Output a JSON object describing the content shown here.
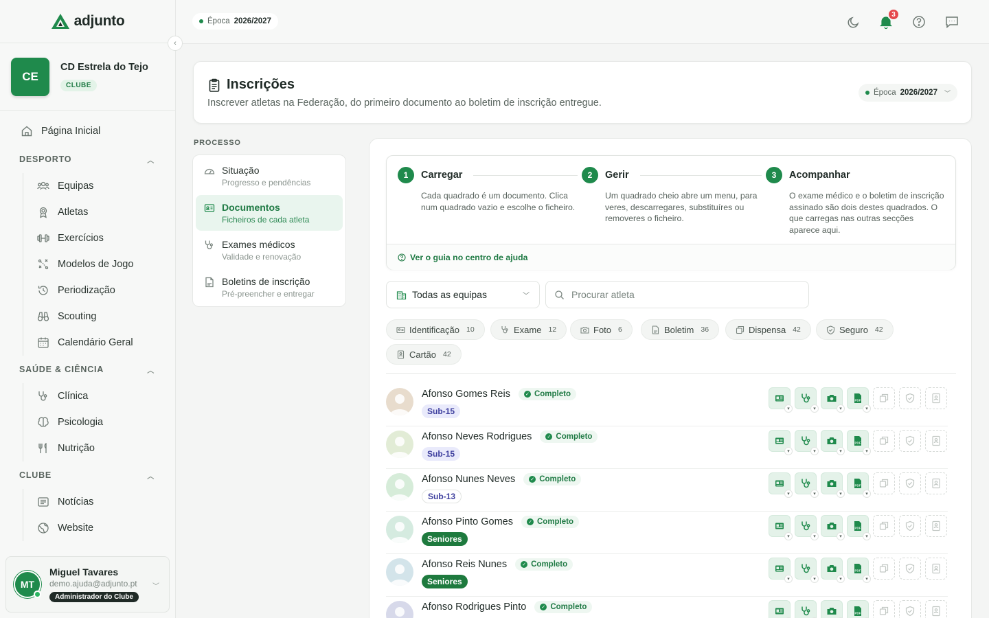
{
  "brand": {
    "name": "adjunto"
  },
  "club": {
    "initials": "CE",
    "name": "CD Estrela do Tejo",
    "badge": "CLUBE"
  },
  "nav": {
    "home": "Página Inicial",
    "sections": [
      {
        "label": "DESPORTO",
        "items": [
          "Equipas",
          "Atletas",
          "Exercícios",
          "Modelos de Jogo",
          "Periodização",
          "Scouting",
          "Calendário Geral"
        ]
      },
      {
        "label": "SAÚDE & CIÊNCIA",
        "items": [
          "Clínica",
          "Psicologia",
          "Nutrição"
        ]
      },
      {
        "label": "CLUBE",
        "items": [
          "Notícias",
          "Website"
        ]
      }
    ]
  },
  "user": {
    "initials": "MT",
    "name": "Miguel Tavares",
    "email": "demo.ajuda@adjunto.pt",
    "role": "Administrador do Clube"
  },
  "topbar": {
    "season_label": "Época",
    "season_value": "2026/2027",
    "notifications": "3"
  },
  "header": {
    "title": "Inscrições",
    "subtitle": "Inscrever atletas na Federação, do primeiro documento ao boletim de inscrição entregue.",
    "season_label": "Época",
    "season_value": "2026/2027"
  },
  "process": {
    "label": "PROCESSO",
    "items": [
      {
        "title": "Situação",
        "sub": "Progresso e pendências"
      },
      {
        "title": "Documentos",
        "sub": "Ficheiros de cada atleta"
      },
      {
        "title": "Exames médicos",
        "sub": "Validade e renovação"
      },
      {
        "title": "Boletins de inscrição",
        "sub": "Pré-preencher e entregar"
      }
    ]
  },
  "steps": [
    {
      "num": "1",
      "title": "Carregar",
      "text": "Cada quadrado é um documento. Clica num quadrado vazio e escolhe o ficheiro."
    },
    {
      "num": "2",
      "title": "Gerir",
      "text": "Um quadrado cheio abre um menu, para veres, descarregares, substituíres ou removeres o ficheiro."
    },
    {
      "num": "3",
      "title": "Acompanhar",
      "text": "O exame médico e o boletim de inscrição assinado são dois destes quadrados. O que carregas nas outras secções aparece aqui."
    }
  ],
  "guide_link": "Ver o guia no centro de ajuda",
  "team_select": "Todas as equipas",
  "search": {
    "placeholder": "Procurar atleta"
  },
  "filters": [
    {
      "label": "Identificação",
      "count": "10"
    },
    {
      "label": "Exame",
      "count": "12"
    },
    {
      "label": "Foto",
      "count": "6"
    },
    {
      "label": "Boletim",
      "count": "36"
    },
    {
      "label": "Dispensa",
      "count": "42"
    },
    {
      "label": "Seguro",
      "count": "42"
    },
    {
      "label": "Cartão",
      "count": "42"
    }
  ],
  "athletes": [
    {
      "name": "Afonso Gomes Reis",
      "status": "Completo",
      "team": "Sub-15",
      "tag": "light",
      "avatar": "#e8dccd"
    },
    {
      "name": "Afonso Neves Rodrigues",
      "status": "Completo",
      "team": "Sub-15",
      "tag": "light",
      "avatar": "#e2ecd6"
    },
    {
      "name": "Afonso Nunes Neves",
      "status": "Completo",
      "team": "Sub-13",
      "tag": "white",
      "avatar": "#d6ecd9"
    },
    {
      "name": "Afonso Pinto Gomes",
      "status": "Completo",
      "team": "Seniores",
      "tag": "dark",
      "avatar": "#d5ebe0"
    },
    {
      "name": "Afonso Reis Nunes",
      "status": "Completo",
      "team": "Seniores",
      "tag": "dark",
      "avatar": "#d3e4ea"
    },
    {
      "name": "Afonso Rodrigues Pinto",
      "status": "Completo",
      "team": "",
      "tag": "none",
      "avatar": "#d7d9ea"
    }
  ],
  "colors": {
    "accent": "#1f8a4c",
    "badge": "#e5484d"
  }
}
